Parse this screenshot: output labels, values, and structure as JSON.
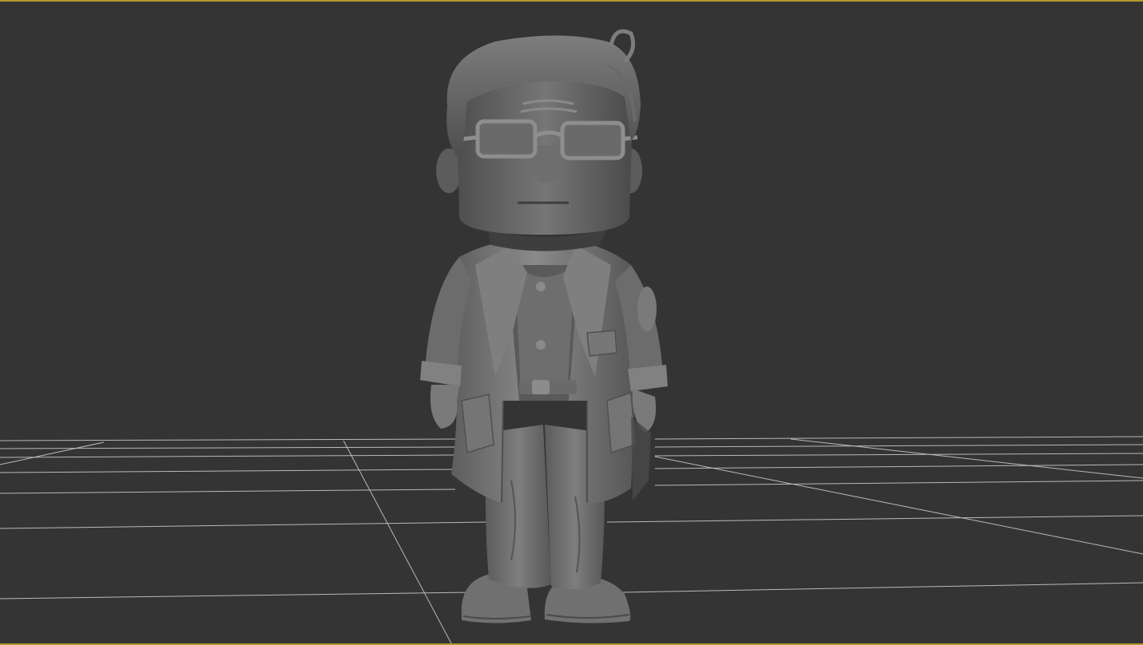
{
  "viewport": {
    "kind": "3d-perspective-viewport",
    "active_border_color": "#b49a2e",
    "background_color": "#343434",
    "grid_color": "#c8c8c8",
    "model_color": "#7a7a7a"
  },
  "scene": {
    "object": "stylized-character-model",
    "shading": "clay"
  }
}
